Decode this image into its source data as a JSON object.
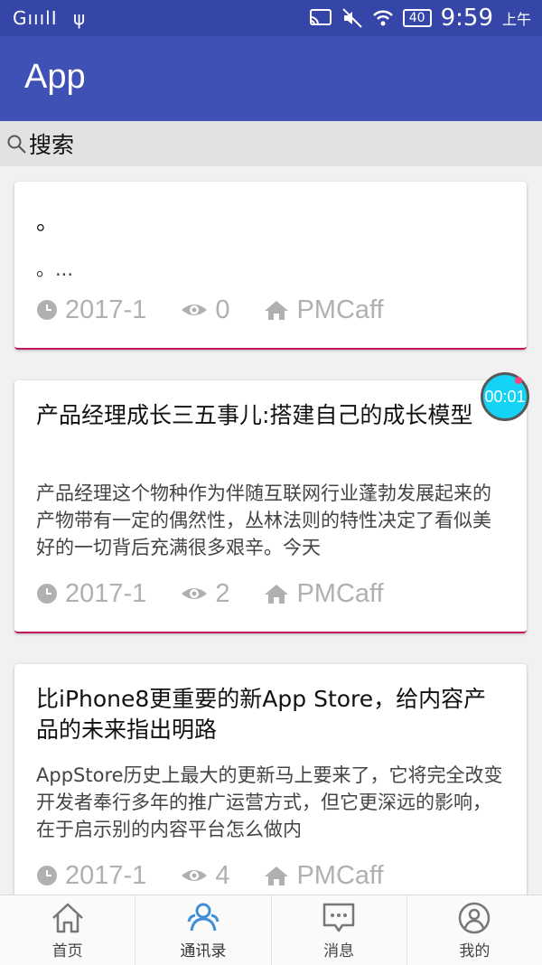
{
  "status_bar": {
    "signal": "GııılI",
    "time": "9:59",
    "ampm": "上午",
    "battery": "40"
  },
  "app_bar": {
    "title": "App"
  },
  "search": {
    "label": "搜索"
  },
  "timer": {
    "label": "00:01"
  },
  "articles": [
    {
      "title": "。",
      "summary": "。...",
      "date": "2017-1",
      "views": "0",
      "source": "PMCaff"
    },
    {
      "title": "产品经理成长三五事儿:搭建自己的成长模型",
      "summary": "产品经理这个物种作为伴随互联网行业蓬勃发展起来的产物带有一定的偶然性，丛林法则的特性决定了看似美好的一切背后充满很多艰辛。今天",
      "date": "2017-1",
      "views": "2",
      "source": "PMCaff"
    },
    {
      "title": "比iPhone8更重要的新App Store，给内容产品的未来指出明路",
      "summary": "AppStore历史上最大的更新马上要来了，它将完全改变开发者奉行多年的推广运营方式，但它更深远的影响，在于启示别的内容平台怎么做内",
      "date": "2017-1",
      "views": "4",
      "source": "PMCaff"
    }
  ],
  "bottom_nav": [
    {
      "label": "首页",
      "icon": "home-icon"
    },
    {
      "label": "通讯录",
      "icon": "contacts-icon",
      "active": true
    },
    {
      "label": "消息",
      "icon": "message-icon"
    },
    {
      "label": "我的",
      "icon": "profile-icon"
    }
  ],
  "colors": {
    "status_bar": "#3545a8",
    "app_bar": "#3f51b5",
    "card_accent": "#c2185b",
    "timer": "#14d3f5",
    "nav_active": "#3f8fd8",
    "meta_gray": "#b0b0b0"
  }
}
